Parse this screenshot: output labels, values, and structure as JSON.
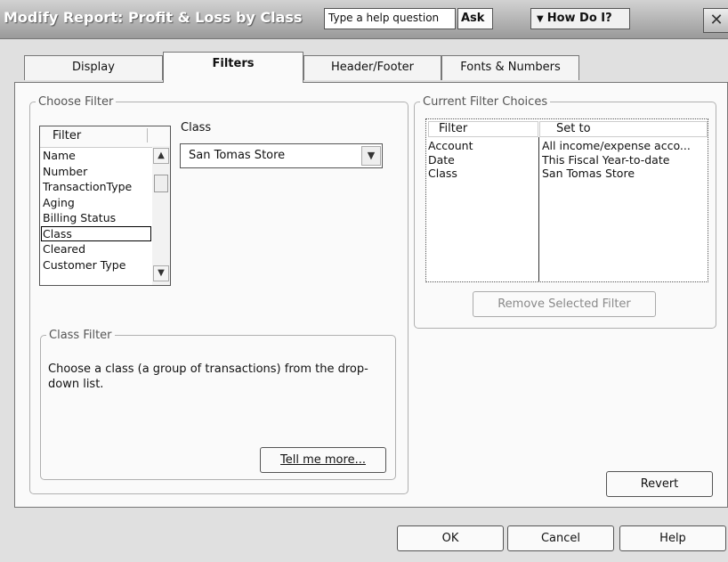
{
  "window": {
    "title": "Modify Report: Profit & Loss by Class",
    "help_placeholder": "Type a help question",
    "ask_label": "Ask",
    "howdoi_label": "How Do I?",
    "close_glyph": "✕"
  },
  "tabs": [
    {
      "label": "Display",
      "active": false
    },
    {
      "label": "Filters",
      "active": true
    },
    {
      "label": "Header/Footer",
      "active": false
    },
    {
      "label": "Fonts & Numbers",
      "active": false
    }
  ],
  "choose_filter": {
    "legend": "Choose Filter",
    "list_header": "Filter",
    "items": [
      "Name",
      "Number",
      "TransactionType",
      "Aging",
      "Billing Status",
      "Class",
      "Cleared",
      "Customer Type"
    ],
    "selected_index": 5,
    "class_label": "Class",
    "class_value": "San Tomas Store"
  },
  "class_filter": {
    "legend": "Class Filter",
    "description": "Choose a class (a group of transactions) from the drop-down list.",
    "tell_me_more": "Tell me more..."
  },
  "current_filters": {
    "legend": "Current Filter Choices",
    "col_filter": "Filter",
    "col_set_to": "Set to",
    "rows": [
      {
        "filter": "Account",
        "set_to": "All income/expense acco..."
      },
      {
        "filter": "Date",
        "set_to": "This Fiscal Year-to-date"
      },
      {
        "filter": "Class",
        "set_to": "San Tomas Store"
      }
    ],
    "remove_label": "Remove Selected Filter"
  },
  "buttons": {
    "revert": "Revert",
    "ok": "OK",
    "cancel": "Cancel",
    "help": "Help"
  }
}
